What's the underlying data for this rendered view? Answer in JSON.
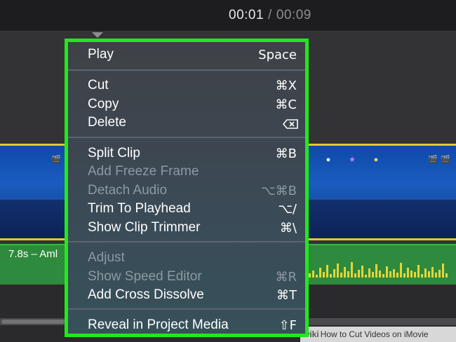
{
  "header": {
    "current_time": "00:01",
    "separator": "/",
    "total_time": "00:09"
  },
  "audio": {
    "label": "7.8s – Aml"
  },
  "menu": {
    "items": [
      {
        "label": "Play",
        "shortcut": "Space",
        "enabled": true
      },
      {
        "label": "Cut",
        "shortcut": "⌘X",
        "enabled": true
      },
      {
        "label": "Copy",
        "shortcut": "⌘C",
        "enabled": true
      },
      {
        "label": "Delete",
        "shortcut": "",
        "enabled": true
      },
      {
        "label": "Split Clip",
        "shortcut": "⌘B",
        "enabled": true
      },
      {
        "label": "Add Freeze Frame",
        "shortcut": "",
        "enabled": false
      },
      {
        "label": "Detach Audio",
        "shortcut": "⌥⌘B",
        "enabled": false
      },
      {
        "label": "Trim To Playhead",
        "shortcut": "⌥/",
        "enabled": true
      },
      {
        "label": "Show Clip Trimmer",
        "shortcut": "⌘\\",
        "enabled": true
      },
      {
        "label": "Adjust",
        "shortcut": "",
        "enabled": false
      },
      {
        "label": "Show Speed Editor",
        "shortcut": "⌘R",
        "enabled": false
      },
      {
        "label": "Add Cross Dissolve",
        "shortcut": "⌘T",
        "enabled": true
      },
      {
        "label": "Reveal in Project Media",
        "shortcut": "⇧F",
        "enabled": true
      }
    ]
  },
  "watermark": {
    "brand": "wiki",
    "text": "How to Cut Videos on iMovie"
  },
  "colors": {
    "highlight_border": "#22e81c",
    "video_track_border": "#e6c630",
    "audio_track": "#2e8a3c",
    "waveform": "#e5d53a"
  }
}
